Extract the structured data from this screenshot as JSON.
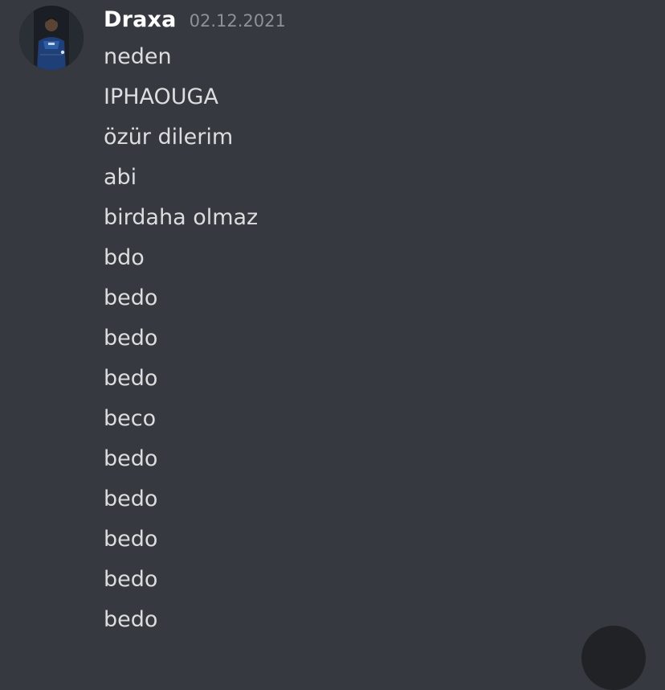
{
  "author": {
    "username": "Draxa",
    "timestamp": "02.12.2021",
    "avatar_icon": "user-avatar-photo"
  },
  "messages": [
    "neden",
    "IPHAOUGA",
    "özür dilerim",
    "abi",
    "birdaha olmaz",
    "bdo",
    "bedo",
    "bedo",
    "bedo",
    "beco",
    "bedo",
    "bedo",
    "bedo",
    "bedo",
    "bedo"
  ],
  "colors": {
    "background": "#36393f",
    "username": "#ffffff",
    "timestamp": "#8e9297",
    "message_text": "#dcddde",
    "floating_button": "#202225"
  }
}
